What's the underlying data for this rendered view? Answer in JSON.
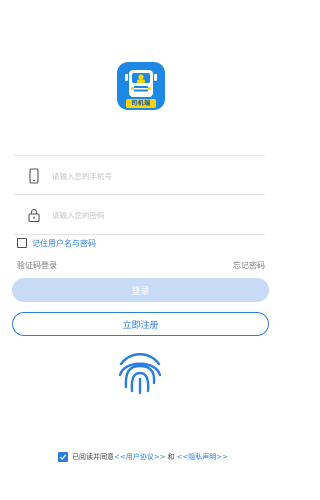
{
  "app": {
    "logo_label": "司机端",
    "logo_color": "#1e88e5",
    "badge_color": "#ffd400"
  },
  "form": {
    "phone_placeholder": "请输入您的手机号",
    "password_placeholder": "请输入您的密码",
    "phone_icon": "phone-icon",
    "lock_icon": "lock-icon",
    "remember_label": "记住用户名与密码",
    "remember_checked": false
  },
  "links": {
    "sms_login": "验证码登录",
    "forgot_password": "忘记密码"
  },
  "buttons": {
    "login": "登录",
    "register": "立即注册"
  },
  "fingerprint": {
    "icon": "fingerprint-icon"
  },
  "agreement": {
    "checked": true,
    "prefix": "已阅读并同意",
    "user_agreement": "<<用户协议>>",
    "conjunction": "和",
    "privacy_policy": "<<隐私声明>>"
  },
  "colors": {
    "accent": "#2a7de1",
    "login_disabled": "#c7dbf7"
  }
}
